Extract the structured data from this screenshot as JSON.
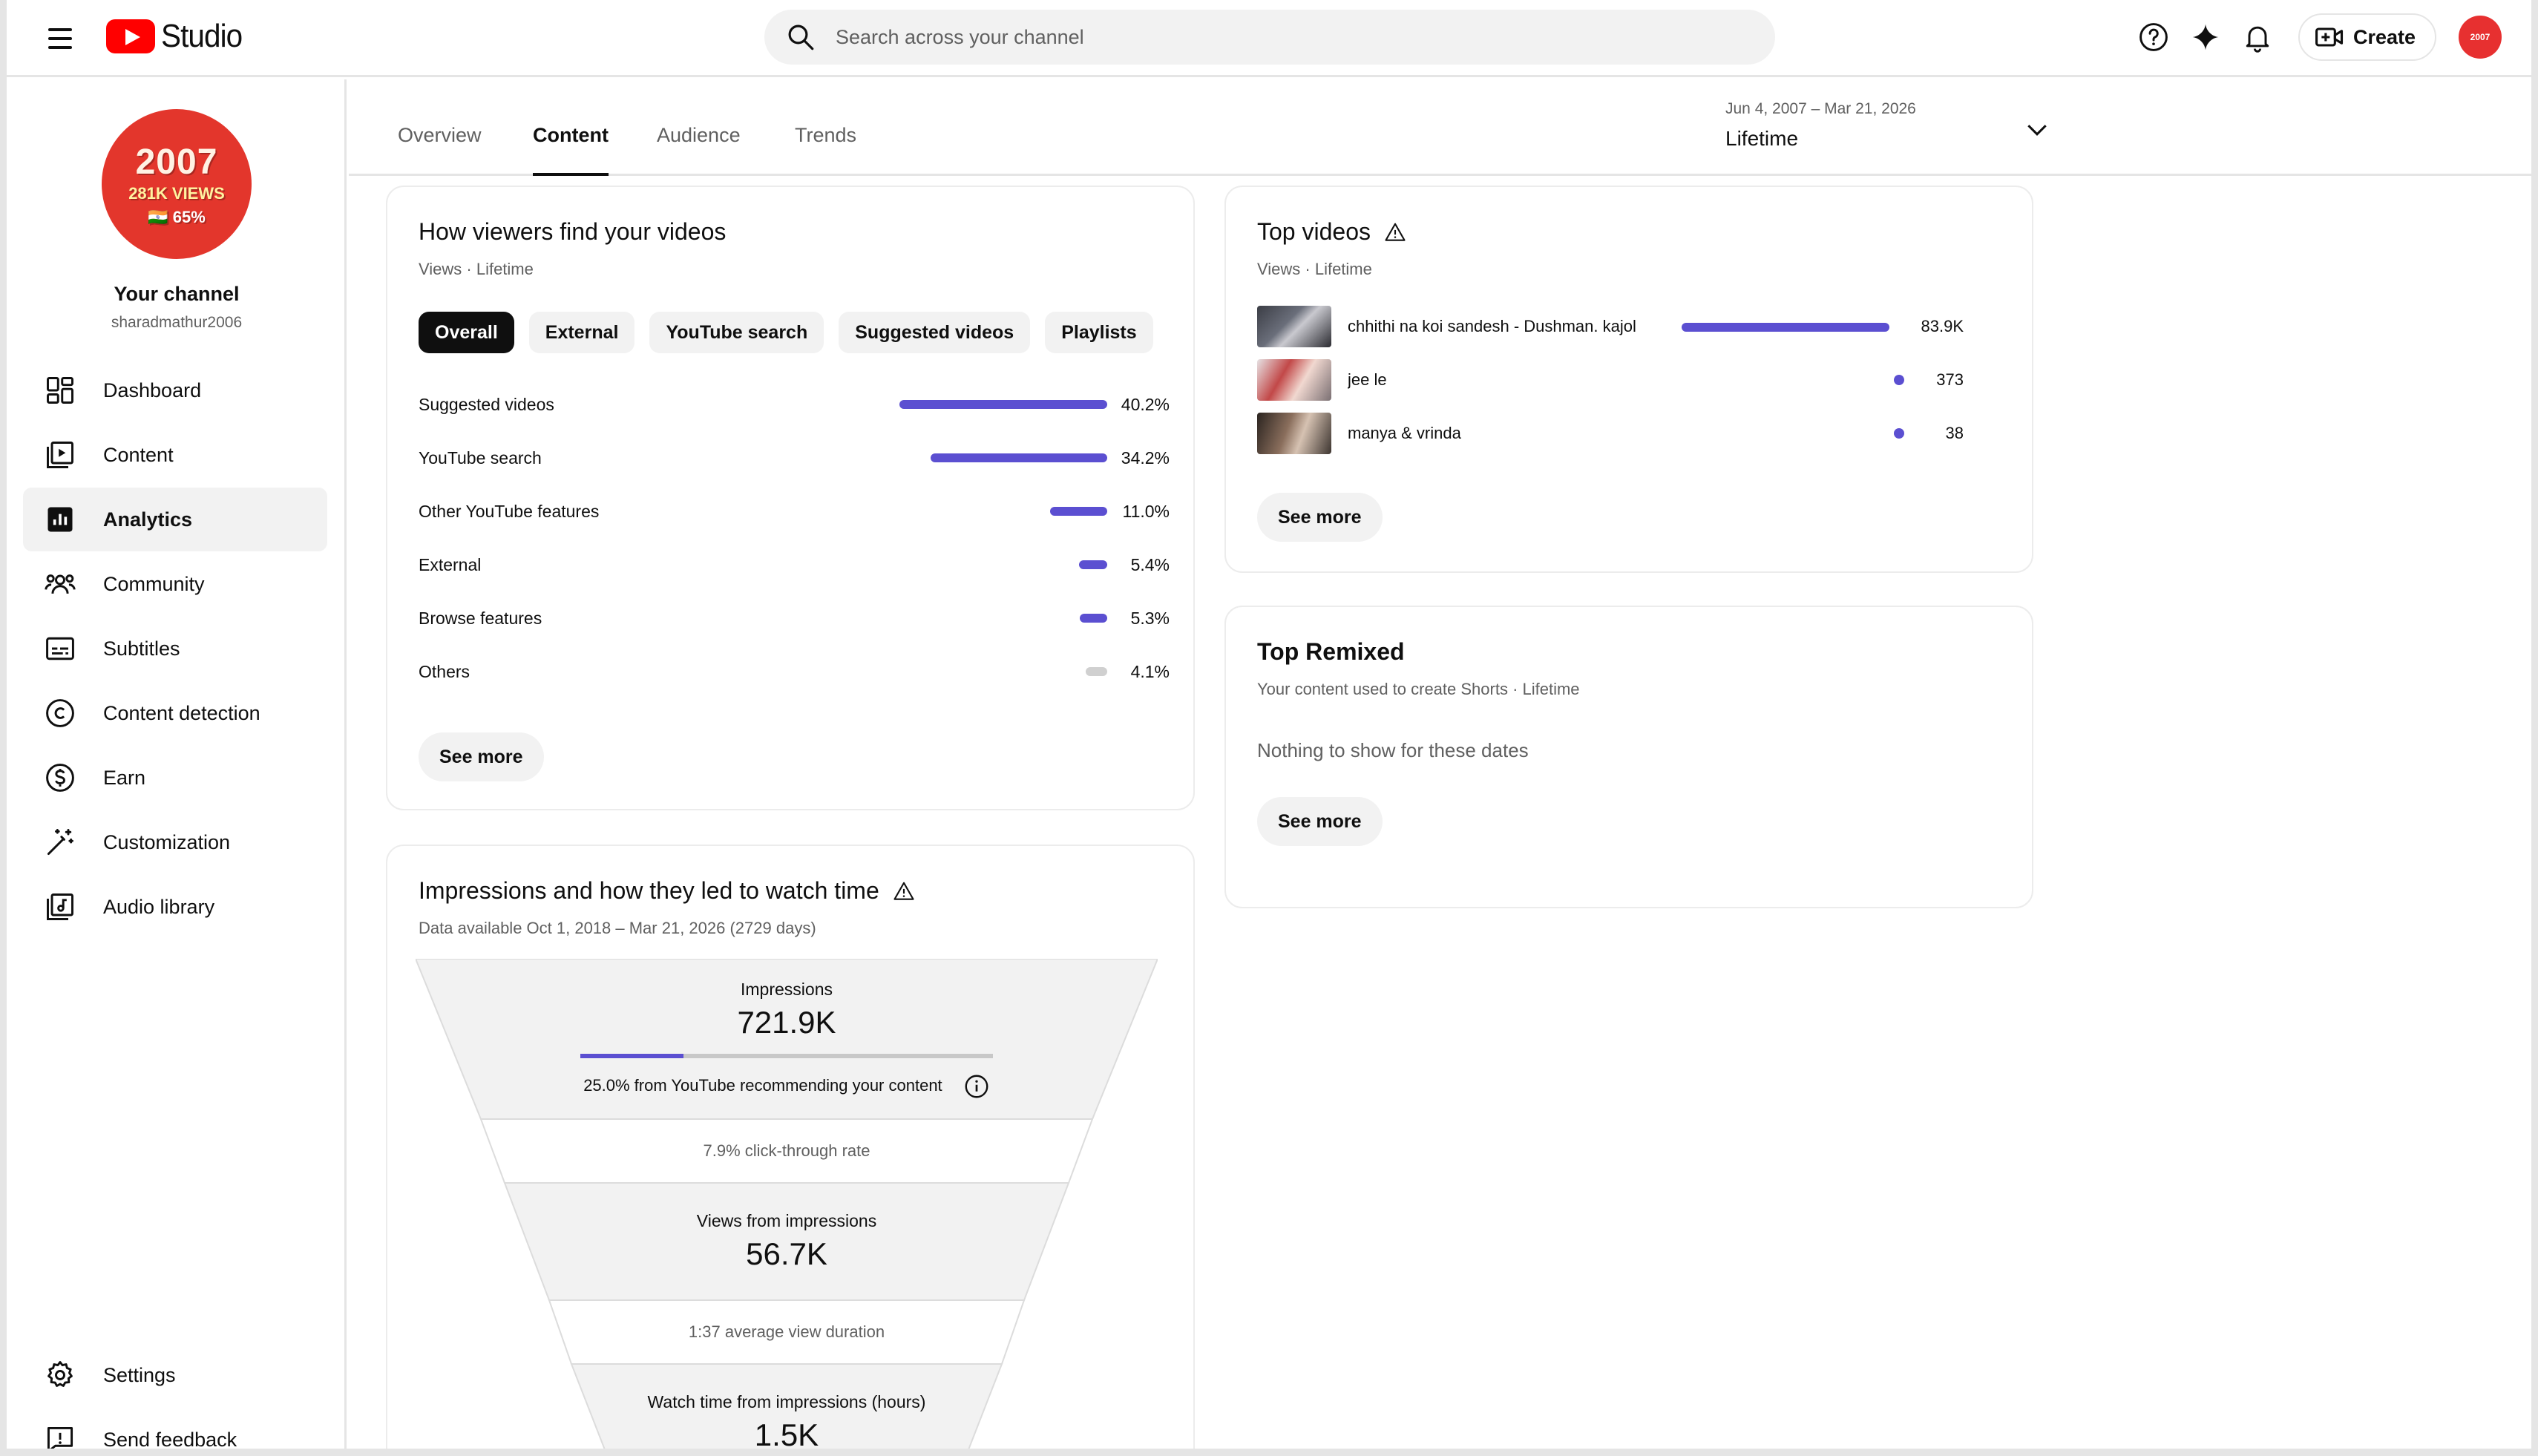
{
  "app": {
    "logo_text": "Studio"
  },
  "search": {
    "placeholder": "Search across your channel"
  },
  "topbar": {
    "create_label": "Create",
    "avatar_text": "2007"
  },
  "channel": {
    "avatar_year": "2007",
    "avatar_views": "281K VIEWS",
    "avatar_percent": "🇮🇳 65%",
    "name": "Your channel",
    "handle": "sharadmathur2006"
  },
  "sidebar": {
    "items": [
      {
        "label": "Dashboard",
        "icon": "dashboard-icon"
      },
      {
        "label": "Content",
        "icon": "content-icon"
      },
      {
        "label": "Analytics",
        "icon": "analytics-icon",
        "active": true
      },
      {
        "label": "Community",
        "icon": "community-icon"
      },
      {
        "label": "Subtitles",
        "icon": "subtitles-icon"
      },
      {
        "label": "Content detection",
        "icon": "copyright-icon"
      },
      {
        "label": "Earn",
        "icon": "dollar-icon"
      },
      {
        "label": "Customization",
        "icon": "magic-wand-icon"
      },
      {
        "label": "Audio library",
        "icon": "audio-library-icon"
      }
    ],
    "bottom": [
      {
        "label": "Settings",
        "icon": "gear-icon"
      },
      {
        "label": "Send feedback",
        "icon": "feedback-icon"
      }
    ]
  },
  "tabs": [
    "Overview",
    "Content",
    "Audience",
    "Trends"
  ],
  "active_tab": "Content",
  "date_range": {
    "range": "Jun 4, 2007 – Mar 21, 2026",
    "label": "Lifetime"
  },
  "traffic": {
    "title": "How viewers find your videos",
    "subtitle": "Views · Lifetime",
    "chips": [
      "Overall",
      "External",
      "YouTube search",
      "Suggested videos",
      "Playlists"
    ],
    "active_chip": "Overall",
    "rows": [
      {
        "label": "Suggested videos",
        "value": "40.2%",
        "pct": 40.2
      },
      {
        "label": "YouTube search",
        "value": "34.2%",
        "pct": 34.2
      },
      {
        "label": "Other YouTube features",
        "value": "11.0%",
        "pct": 11.0
      },
      {
        "label": "External",
        "value": "5.4%",
        "pct": 5.4
      },
      {
        "label": "Browse features",
        "value": "5.3%",
        "pct": 5.3
      },
      {
        "label": "Others",
        "value": "4.1%",
        "pct": 4.1,
        "grey": true
      }
    ],
    "see_more": "See more"
  },
  "top_videos": {
    "title": "Top videos",
    "subtitle": "Views · Lifetime",
    "rows": [
      {
        "title": "chhithi na koi sandesh - Dushman. kajol",
        "value": "83.9K",
        "views": 83900
      },
      {
        "title": "jee le",
        "value": "373",
        "views": 373
      },
      {
        "title": "manya & vrinda",
        "value": "38",
        "views": 38
      }
    ],
    "see_more": "See more"
  },
  "top_remixed": {
    "title": "Top Remixed",
    "subtitle": "Your content used to create Shorts · Lifetime",
    "empty": "Nothing to show for these dates",
    "see_more": "See more"
  },
  "impressions": {
    "title": "Impressions and how they led to watch time",
    "subtitle": "Data available Oct 1, 2018 – Mar 21, 2026 (2729 days)",
    "impressions_label": "Impressions",
    "impressions_value": "721.9K",
    "recommended_pct": 25.0,
    "recommended_text": "25.0% from YouTube recommending your content",
    "ctr_text": "7.9% click-through rate",
    "views_label": "Views from impressions",
    "views_value": "56.7K",
    "avd_text": "1:37 average view duration",
    "watch_label": "Watch time from impressions (hours)",
    "watch_value": "1.5K"
  },
  "colors": {
    "accent": "#5b4fd1",
    "brand_red": "#ff0000",
    "chip_bg": "#f2f2f2"
  }
}
